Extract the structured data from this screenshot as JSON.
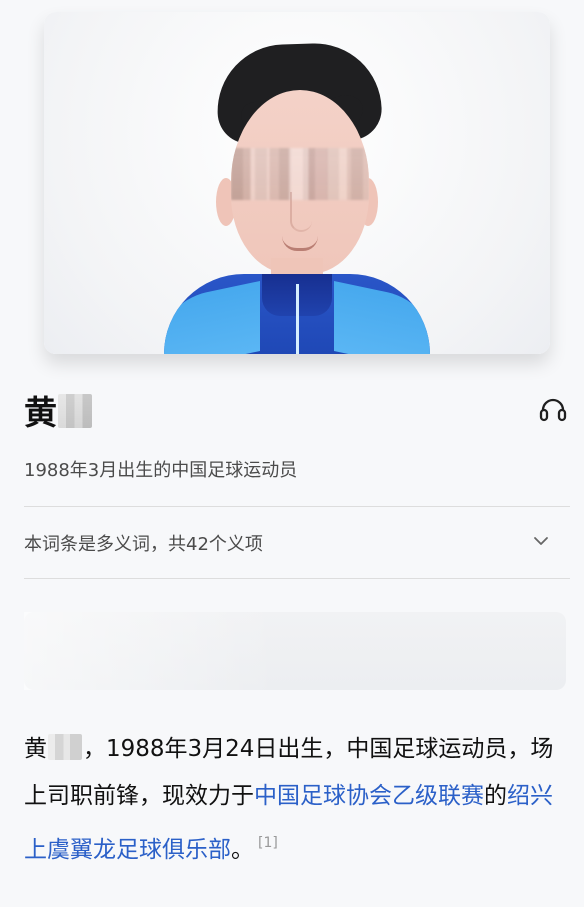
{
  "profile": {
    "name_visible": "黄",
    "subtitle": "1988年3月出生的中国足球运动员",
    "disambiguation": "本词条是多义词，共42个义项",
    "article": {
      "part1": "，1988年3月24日出生，中国足球运动员，场上司职前锋，现效力于",
      "link1": "中国足球协会乙级联赛",
      "part2": "的",
      "link2": "绍兴上虞翼龙足球俱乐部",
      "part3": "。",
      "citation": "[1]"
    }
  },
  "icons": {
    "audio": "headphones-icon",
    "expand": "chevron-down-icon"
  },
  "colors": {
    "link": "#2b60c8",
    "jacket_dark": "#2047b5",
    "jacket_light": "#56b4f2"
  }
}
